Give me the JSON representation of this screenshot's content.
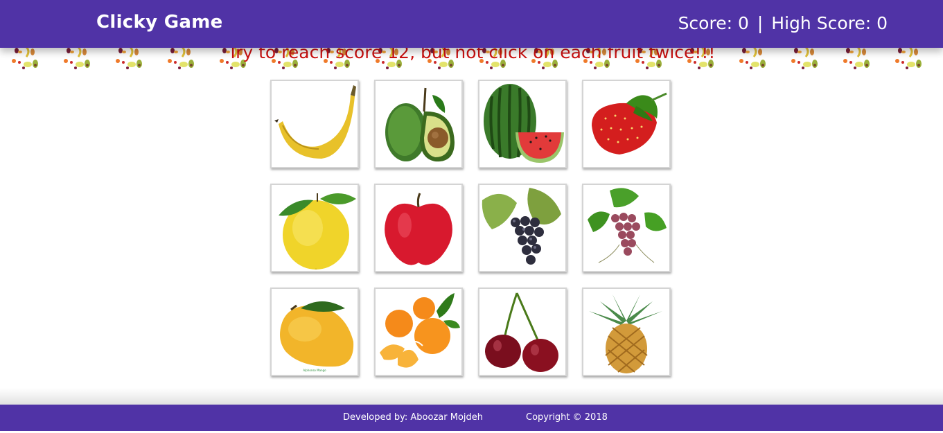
{
  "navbar": {
    "brand": "Clicky Game",
    "score_label": "Score: 0",
    "separator": "|",
    "high_score_label": "High Score: 0",
    "color": "#5033a6"
  },
  "message": "Try to reach score 12, but not click on each fruit twice!!!",
  "cards": [
    {
      "icon": "banana-icon"
    },
    {
      "icon": "avocado-icon"
    },
    {
      "icon": "watermelon-icon"
    },
    {
      "icon": "strawberry-icon"
    },
    {
      "icon": "lemon-icon"
    },
    {
      "icon": "apple-icon"
    },
    {
      "icon": "black-grapes-icon"
    },
    {
      "icon": "red-grapes-icon"
    },
    {
      "icon": "mango-icon",
      "caption": "Alphonso Mango"
    },
    {
      "icon": "orange-icon"
    },
    {
      "icon": "cherries-icon"
    },
    {
      "icon": "pineapple-icon"
    }
  ],
  "footer": {
    "developer": "Developed by: Aboozar Mojdeh",
    "copyright": "Copyright © 2018"
  },
  "colors": {
    "accent": "#5033a6",
    "message": "#cc1111"
  }
}
